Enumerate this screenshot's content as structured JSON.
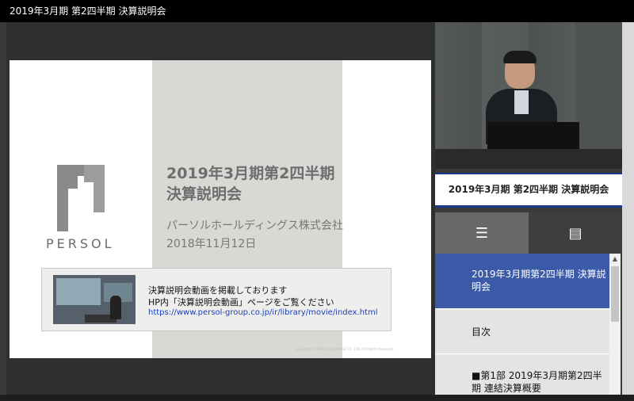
{
  "window": {
    "title": "2019年3月期 第2四半期 決算説明会"
  },
  "slide": {
    "logo_text": "PERSOL",
    "title_line1": "2019年3月期第2四半期",
    "title_line2": "決算説明会",
    "company": "パーソルホールディングス株式会社",
    "date": "2018年11月12日",
    "notice_line1": "決算説明会動画を掲載しております",
    "notice_line2": "HP内「決算説明会動画」ページをご覧ください",
    "notice_url": "https://www.persol-group.co.jp/ir/library/movie/index.html",
    "copyright": "Copyright © PERSOL HOLDINGS CO., LTD. All Rights Reserved."
  },
  "sidebar": {
    "event_title": "2019年3月期 第2四半期 決算説明会",
    "tabs": [
      {
        "name": "toc",
        "icon": "list-icon",
        "glyph": "☰"
      },
      {
        "name": "notes",
        "icon": "notes-icon",
        "glyph": "▤"
      }
    ],
    "items": [
      {
        "label": "2019年3月期第2四半期 決算説明会",
        "active": true
      },
      {
        "label": "目次",
        "active": false
      },
      {
        "label": "■第1部 2019年3月期第2四半期 連結決算概要",
        "active": false
      }
    ]
  },
  "colors": {
    "accent": "#3b5aa8",
    "header": "#000000",
    "brand_grey": "#6e6e6e"
  }
}
